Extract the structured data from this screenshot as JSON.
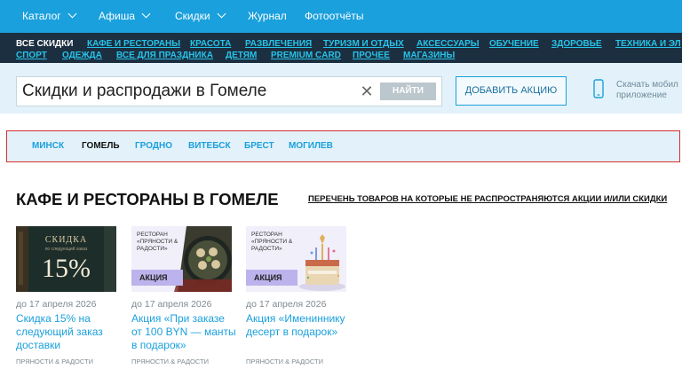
{
  "topnav": {
    "catalog": "Каталог",
    "afisha": "Афиша",
    "discounts": "Скидки",
    "journal": "Журнал",
    "photoreports": "Фотоотчёты"
  },
  "categories": {
    "row1": [
      "ВСЕ СКИДКИ",
      "КАФЕ И РЕСТОРАНЫ",
      "КРАСОТА",
      "РАЗВЛЕЧЕНИЯ",
      "ТУРИЗМ И ОТДЫХ",
      "АКСЕССУАРЫ",
      "ОБУЧЕНИЕ",
      "ЗДОРОВЬЕ",
      "ТЕХНИКА И ЭЛ"
    ],
    "row2": [
      "СПОРТ",
      "ОДЕЖДА",
      "ВСЕ ДЛЯ ПРАЗДНИКА",
      "ДЕТЯМ",
      "PREMIUM CARD",
      "ПРОЧЕЕ",
      "МАГАЗИНЫ"
    ]
  },
  "search": {
    "value": "Скидки и распродажи в Гомеле",
    "clear_glyph": "✕",
    "button": "НАЙТИ"
  },
  "add_promo": "ДОБАВИТЬ АКЦИЮ",
  "app": {
    "line1": "Скачать мобил",
    "line2": "приложение"
  },
  "cities": [
    "МИНСК",
    "ГОМЕЛЬ",
    "ГРОДНО",
    "ВИТЕБСК",
    "БРЕСТ",
    "МОГИЛЕВ"
  ],
  "heading": {
    "title": "КАФЕ И РЕСТОРАНЫ В ГОМЕЛЕ",
    "exclusions_link": "ПЕРЕЧЕНЬ ТОВАРОВ НА КОТОРЫЕ НЕ РАСПРОСТРАНЯЮТСЯ АКЦИИ И/ИЛИ СКИДКИ"
  },
  "cards": [
    {
      "image": {
        "label": "СКИДКА",
        "sub": "по следующий заказ",
        "big": "15%"
      },
      "date": "до 17 апреля 2026",
      "title": "Скидка 15% на следующий заказ доставки",
      "shop": "ПРЯНОСТИ & РАДОСТИ"
    },
    {
      "image": {
        "label": "РЕСТОРАН «ПРЯНОСТИ & РАДОСТИ»",
        "tag": "АКЦИЯ"
      },
      "date": "до 17 апреля 2026",
      "title": "Акция «При заказе от 100 BYN — манты в подарок»",
      "shop": "ПРЯНОСТИ & РАДОСТИ"
    },
    {
      "image": {
        "label": "РЕСТОРАН «ПРЯНОСТИ & РАДОСТИ»",
        "tag": "АКЦИЯ"
      },
      "date": "до 17 апреля 2026",
      "title": "Акция «Имениннику десерт в подарок»",
      "shop": "ПРЯНОСТИ & РАДОСТИ"
    }
  ],
  "colors": {
    "brand_blue": "#1aa0dc",
    "dark_bar": "#1c2f40",
    "category_link": "#27c3e9",
    "light_bg": "#e3f2fa",
    "highlight_border": "#d62f2f",
    "promo_tag": "#bcb3ec"
  },
  "icons": [
    "chevron-down-icon",
    "close-icon",
    "phone-icon"
  ]
}
